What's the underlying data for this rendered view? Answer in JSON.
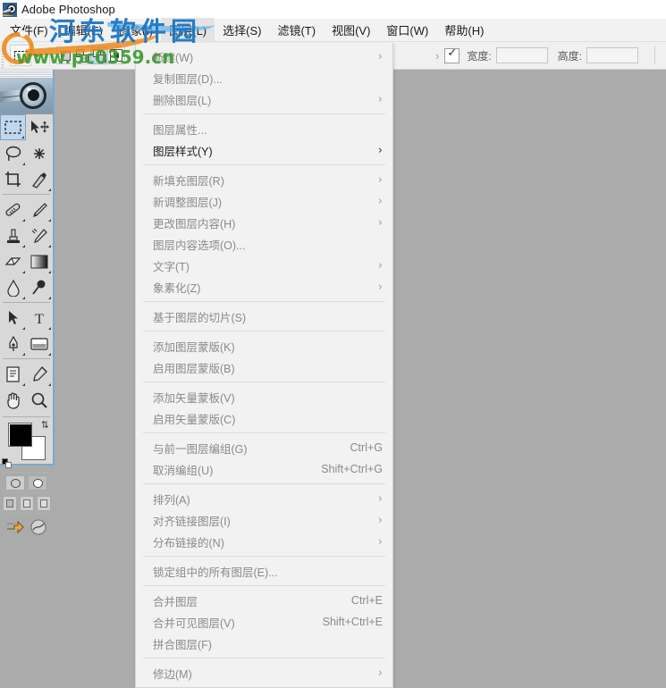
{
  "titlebar": {
    "app_title": "Adobe Photoshop",
    "logo_icon": "photoshop-eye-icon"
  },
  "menubar": {
    "items": [
      {
        "label": "文件(F)",
        "active": false
      },
      {
        "label": "编辑(E)",
        "active": false
      },
      {
        "label": "图象(I)",
        "active": false
      },
      {
        "label": "图层(L)",
        "active": true
      },
      {
        "label": "选择(S)",
        "active": false
      },
      {
        "label": "滤镜(T)",
        "active": false
      },
      {
        "label": "视图(V)",
        "active": false
      },
      {
        "label": "窗口(W)",
        "active": false
      },
      {
        "label": "帮助(H)",
        "active": false
      }
    ]
  },
  "options_bar": {
    "tool_icon": "rectangular-marquee-icon",
    "tool_preset_caret": "chevron-down-icon",
    "selection_modes": [
      {
        "name": "new-selection",
        "selected": false
      },
      {
        "name": "add-to-selection",
        "selected": false
      },
      {
        "name": "subtract-from-selection",
        "selected": true
      },
      {
        "name": "intersect-with-selection",
        "selected": false
      }
    ],
    "overflow_arrow": "›",
    "constrain_checkbox_checked": true,
    "width_label": "宽度:",
    "width_value": "",
    "height_label": "高度:",
    "height_value": ""
  },
  "toolbox": {
    "logo_icon": "photoshop-eye-logo",
    "tools": [
      {
        "name": "rectangular-marquee-tool",
        "selected": true,
        "has_flyout": true
      },
      {
        "name": "move-tool",
        "selected": false,
        "has_flyout": false
      },
      {
        "name": "lasso-tool",
        "selected": false,
        "has_flyout": true
      },
      {
        "name": "magic-wand-tool",
        "selected": false,
        "has_flyout": false
      },
      {
        "name": "crop-tool",
        "selected": false,
        "has_flyout": false
      },
      {
        "name": "slice-tool",
        "selected": false,
        "has_flyout": true
      },
      {
        "name": "healing-brush-tool",
        "selected": false,
        "has_flyout": true
      },
      {
        "name": "brush-tool",
        "selected": false,
        "has_flyout": true
      },
      {
        "name": "clone-stamp-tool",
        "selected": false,
        "has_flyout": true
      },
      {
        "name": "history-brush-tool",
        "selected": false,
        "has_flyout": true
      },
      {
        "name": "eraser-tool",
        "selected": false,
        "has_flyout": true
      },
      {
        "name": "gradient-tool",
        "selected": false,
        "has_flyout": true
      },
      {
        "name": "blur-tool",
        "selected": false,
        "has_flyout": true
      },
      {
        "name": "dodge-tool",
        "selected": false,
        "has_flyout": true
      },
      {
        "name": "path-selection-tool",
        "selected": false,
        "has_flyout": true
      },
      {
        "name": "type-tool",
        "selected": false,
        "has_flyout": true
      },
      {
        "name": "pen-tool",
        "selected": false,
        "has_flyout": true
      },
      {
        "name": "shape-tool",
        "selected": false,
        "has_flyout": true
      },
      {
        "name": "notes-tool",
        "selected": false,
        "has_flyout": true
      },
      {
        "name": "eyedropper-tool",
        "selected": false,
        "has_flyout": true
      },
      {
        "name": "hand-tool",
        "selected": false,
        "has_flyout": false
      },
      {
        "name": "zoom-tool",
        "selected": false,
        "has_flyout": false
      }
    ],
    "colors": {
      "foreground": "#000000",
      "background": "#ffffff",
      "swap_icon": "swap-colors-icon",
      "default_icon": "default-colors-icon"
    },
    "mask_modes": [
      {
        "name": "standard-mode-button",
        "selected": false
      },
      {
        "name": "quick-mask-mode-button",
        "selected": true
      }
    ],
    "screen_modes": [
      {
        "name": "standard-screen-mode-button",
        "selected": true
      },
      {
        "name": "full-screen-with-menubar-button",
        "selected": false
      },
      {
        "name": "full-screen-mode-button",
        "selected": false
      }
    ],
    "jump_to": [
      {
        "name": "jump-to-imageready-button"
      },
      {
        "name": "imageready-icon"
      }
    ]
  },
  "layer_menu": {
    "groups": [
      {
        "rows": [
          {
            "label": "新建(W)",
            "accel": "",
            "submenu": true,
            "emphasis": false
          },
          {
            "label": "复制图层(D)...",
            "accel": "",
            "submenu": false,
            "emphasis": false
          },
          {
            "label": "删除图层(L)",
            "accel": "",
            "submenu": true,
            "emphasis": false
          }
        ]
      },
      {
        "rows": [
          {
            "label": "图层属性...",
            "accel": "",
            "submenu": false,
            "emphasis": false
          },
          {
            "label": "图层样式(Y)",
            "accel": "",
            "submenu": true,
            "emphasis": true
          }
        ]
      },
      {
        "rows": [
          {
            "label": "新填充图层(R)",
            "accel": "",
            "submenu": true,
            "emphasis": false
          },
          {
            "label": "新调整图层(J)",
            "accel": "",
            "submenu": true,
            "emphasis": false
          },
          {
            "label": "更改图层内容(H)",
            "accel": "",
            "submenu": true,
            "emphasis": false
          },
          {
            "label": "图层内容选项(O)...",
            "accel": "",
            "submenu": false,
            "emphasis": false
          },
          {
            "label": "文字(T)",
            "accel": "",
            "submenu": true,
            "emphasis": false
          },
          {
            "label": "象素化(Z)",
            "accel": "",
            "submenu": true,
            "emphasis": false
          }
        ]
      },
      {
        "rows": [
          {
            "label": "基于图层的切片(S)",
            "accel": "",
            "submenu": false,
            "emphasis": false
          }
        ]
      },
      {
        "rows": [
          {
            "label": "添加图层蒙版(K)",
            "accel": "",
            "submenu": false,
            "emphasis": false
          },
          {
            "label": "启用图层蒙版(B)",
            "accel": "",
            "submenu": false,
            "emphasis": false
          }
        ]
      },
      {
        "rows": [
          {
            "label": "添加矢量蒙板(V)",
            "accel": "",
            "submenu": false,
            "emphasis": false
          },
          {
            "label": "启用矢量蒙版(C)",
            "accel": "",
            "submenu": false,
            "emphasis": false
          }
        ]
      },
      {
        "rows": [
          {
            "label": "与前一图层编组(G)",
            "accel": "Ctrl+G",
            "submenu": false,
            "emphasis": false
          },
          {
            "label": "取消编组(U)",
            "accel": "Shift+Ctrl+G",
            "submenu": false,
            "emphasis": false
          }
        ]
      },
      {
        "rows": [
          {
            "label": "排列(A)",
            "accel": "",
            "submenu": true,
            "emphasis": false
          },
          {
            "label": "对齐链接图层(I)",
            "accel": "",
            "submenu": true,
            "emphasis": false
          },
          {
            "label": "分布链接的(N)",
            "accel": "",
            "submenu": true,
            "emphasis": false
          }
        ]
      },
      {
        "rows": [
          {
            "label": "锁定组中的所有图层(E)...",
            "accel": "",
            "submenu": false,
            "emphasis": false
          }
        ]
      },
      {
        "rows": [
          {
            "label": "合并图层",
            "accel": "Ctrl+E",
            "submenu": false,
            "emphasis": false
          },
          {
            "label": "合并可见图层(V)",
            "accel": "Shift+Ctrl+E",
            "submenu": false,
            "emphasis": false
          },
          {
            "label": "拼合图层(F)",
            "accel": "",
            "submenu": false,
            "emphasis": false
          }
        ]
      },
      {
        "rows": [
          {
            "label": "修边(M)",
            "accel": "",
            "submenu": true,
            "emphasis": false
          }
        ]
      }
    ],
    "submenu_glyph": "›"
  },
  "watermark": {
    "site_name_cn": "河东软件园",
    "site_url": "www.pc0359.cn",
    "color_cn": "#1773c4",
    "color_url": "#3e9e34",
    "color_ring": "#f08a1c"
  },
  "canvas": {
    "background_color": "#ababab"
  }
}
